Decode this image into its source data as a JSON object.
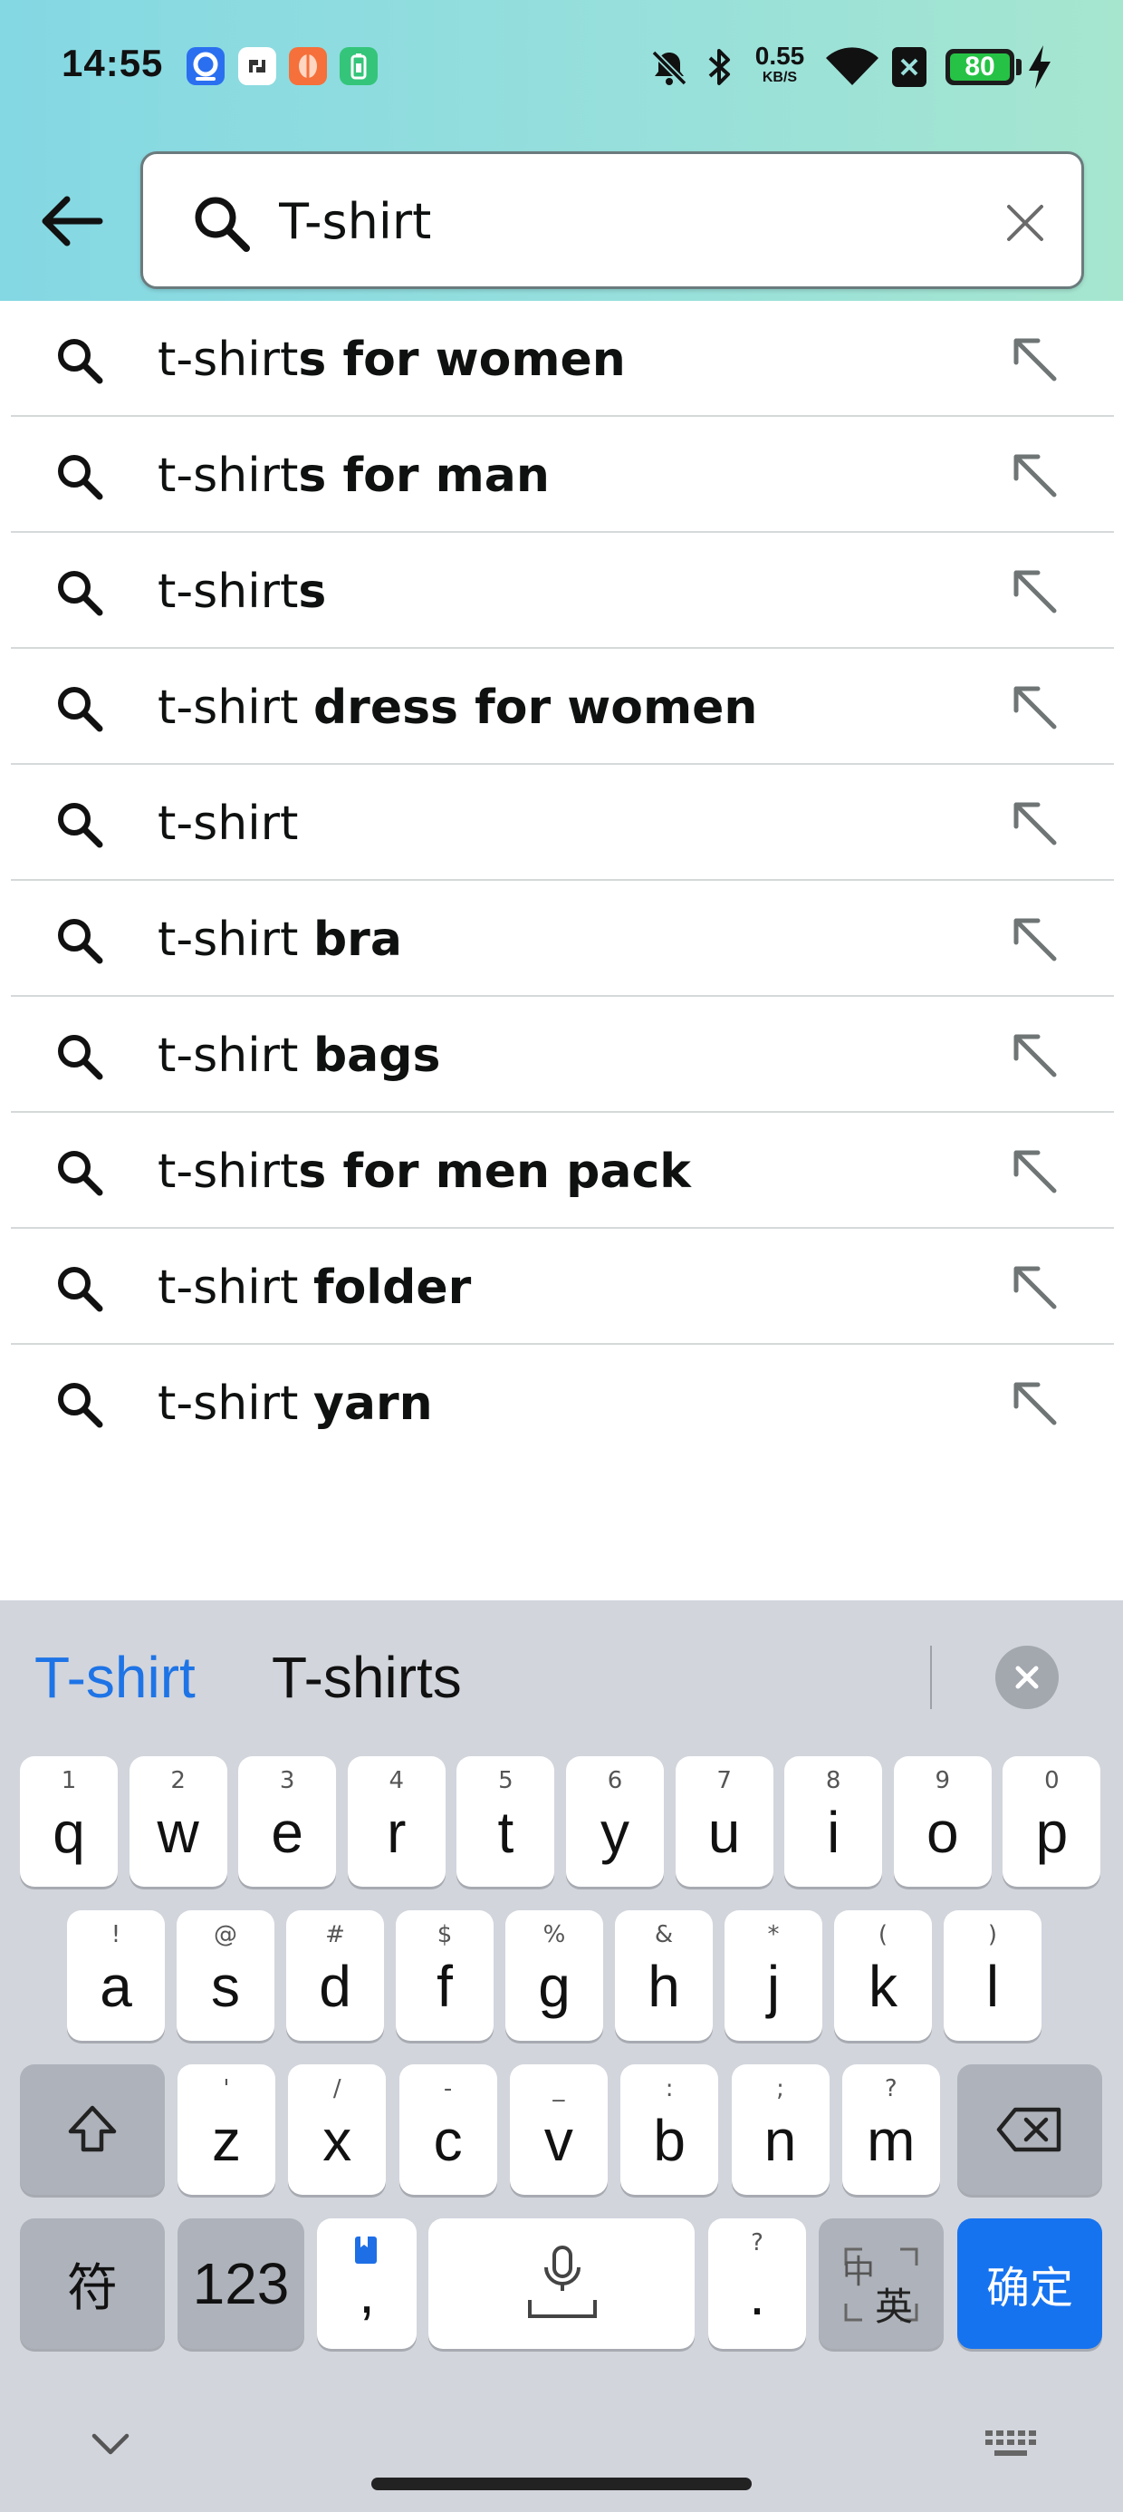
{
  "status_bar": {
    "time": "14:55",
    "net_speed_value": "0.55",
    "net_speed_unit": "KB/S",
    "battery_percent": "80"
  },
  "search": {
    "value": "T-shirt",
    "placeholder": ""
  },
  "suggestions": [
    {
      "prefix": "t-shirt",
      "bold": "s for women"
    },
    {
      "prefix": "t-shirt",
      "bold": "s for man"
    },
    {
      "prefix": "t-shirt",
      "bold": "s"
    },
    {
      "prefix": "t-shirt ",
      "bold": "dress for women"
    },
    {
      "prefix": "t-shirt",
      "bold": ""
    },
    {
      "prefix": "t-shirt ",
      "bold": "bra"
    },
    {
      "prefix": "t-shirt ",
      "bold": "bags"
    },
    {
      "prefix": "t-shirt",
      "bold": "s for men pack"
    },
    {
      "prefix": "t-shirt ",
      "bold": "folder"
    },
    {
      "prefix": "t-shirt ",
      "bold": "yarn"
    }
  ],
  "keyboard": {
    "candidates": [
      "T-shirt",
      "T-shirts"
    ],
    "row1": [
      {
        "main": "q",
        "hint": "1"
      },
      {
        "main": "w",
        "hint": "2"
      },
      {
        "main": "e",
        "hint": "3"
      },
      {
        "main": "r",
        "hint": "4"
      },
      {
        "main": "t",
        "hint": "5"
      },
      {
        "main": "y",
        "hint": "6"
      },
      {
        "main": "u",
        "hint": "7"
      },
      {
        "main": "i",
        "hint": "8"
      },
      {
        "main": "o",
        "hint": "9"
      },
      {
        "main": "p",
        "hint": "0"
      }
    ],
    "row2": [
      {
        "main": "a",
        "hint": "!"
      },
      {
        "main": "s",
        "hint": "@"
      },
      {
        "main": "d",
        "hint": "#"
      },
      {
        "main": "f",
        "hint": "$"
      },
      {
        "main": "g",
        "hint": "%"
      },
      {
        "main": "h",
        "hint": "&"
      },
      {
        "main": "j",
        "hint": "*"
      },
      {
        "main": "k",
        "hint": "("
      },
      {
        "main": "l",
        "hint": ")"
      }
    ],
    "row3": [
      {
        "main": "z",
        "hint": "'"
      },
      {
        "main": "x",
        "hint": "/"
      },
      {
        "main": "c",
        "hint": "-"
      },
      {
        "main": "v",
        "hint": "_"
      },
      {
        "main": "b",
        "hint": ":"
      },
      {
        "main": "n",
        "hint": ";"
      },
      {
        "main": "m",
        "hint": "?"
      }
    ],
    "symbols_key": "符",
    "numbers_key": "123",
    "comma_key": ",",
    "period_key": ".",
    "period_hint": "?",
    "lang_key_top": "中",
    "lang_key_bottom": "英",
    "confirm_key": "确定"
  },
  "colors": {
    "header_gradient_start": "#84d8e3",
    "header_gradient_end": "#a6e6cf",
    "candidate_selected": "#1e74e6",
    "confirm_key": "#1673f0",
    "battery_fill": "#26c245"
  }
}
